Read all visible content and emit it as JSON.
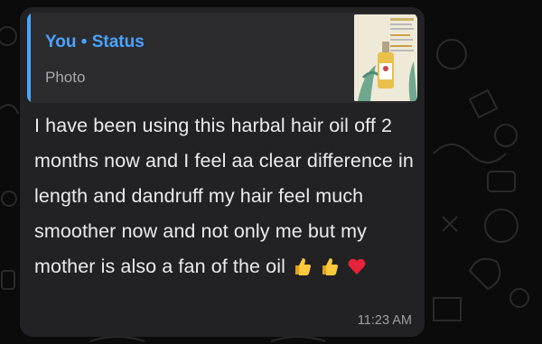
{
  "reply_quote": {
    "sender": "You",
    "separator": "•",
    "context": "Status",
    "media_type": "Photo"
  },
  "message": {
    "text": "I have been using this harbal hair oil off 2 months now and I feel aa clear difference in length and dandruff my hair feel much smoother now and not only me but my mother is also a fan of the oil",
    "emojis": [
      "thumbs-up-icon",
      "thumbs-up-icon",
      "red-heart-icon"
    ],
    "timestamp": "11:23 AM"
  },
  "colors": {
    "accent": "#4aa3ff",
    "bubble": "#222224",
    "quote_bg": "#2c2c2f",
    "text": "#ecebec",
    "muted": "#9e9ea3"
  }
}
